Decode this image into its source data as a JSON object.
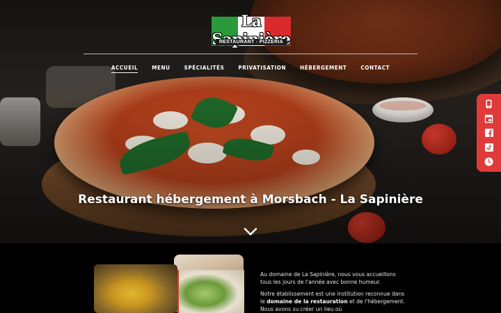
{
  "brand": {
    "name": "La Sapinière",
    "tagline": "RESTAURANT - PIZZERIA",
    "flag_colors": [
      "#2a9a3a",
      "#ffffff",
      "#d92b2b"
    ]
  },
  "nav": {
    "items": [
      {
        "label": "ACCUEIL",
        "active": true
      },
      {
        "label": "MENU",
        "active": false
      },
      {
        "label": "SPÉCIALITÉS",
        "active": false
      },
      {
        "label": "PRIVATISATION",
        "active": false
      },
      {
        "label": "HÉBERGEMENT",
        "active": false
      },
      {
        "label": "CONTACT",
        "active": false
      }
    ]
  },
  "hero": {
    "title": "Restaurant hébergement à Morsbach - La Sapinière",
    "scroll_icon": "chevron-down-icon"
  },
  "social": {
    "accent": "#e03a3a",
    "icons": [
      "phone-icon",
      "store-icon",
      "facebook-icon",
      "tiktok-icon",
      "clock-icon"
    ]
  },
  "intro": {
    "p1": "Au domaine de La Sapinière, nous vous accueillons tous les jours de l'année avec bonne humeur.",
    "p2_before": "Notre établissement est une institution reconnue dans le",
    "p2_bold": "domaine de la restauration",
    "p2_after": "et de l'hébergement. Nous avons su créer un lieu où"
  }
}
